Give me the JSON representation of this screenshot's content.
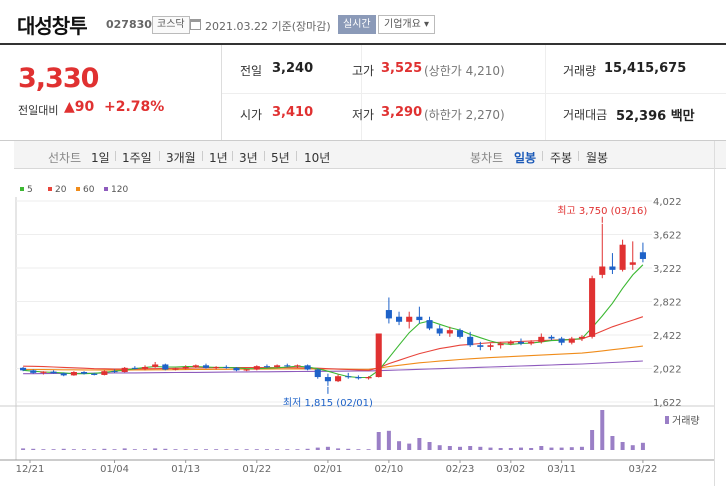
{
  "header": {
    "company_name": "대성창투",
    "code": "027830",
    "market_badge": "코스닥",
    "date_text": "2021.03.22  기준(장마감)",
    "realtime_button": "실시간",
    "company_overview_button": "기업개요 ▾"
  },
  "price": {
    "current": "3,330",
    "change_label": "전일대비",
    "change_value": "▲90",
    "change_pct": "+2.78%"
  },
  "stats": {
    "prev_close_label": "전일",
    "prev_close": "3,240",
    "high_label": "고가",
    "high": "3,525",
    "upper_limit": "(상한가 4,210)",
    "volume_label": "거래량",
    "volume": "15,415,675",
    "open_label": "시가",
    "open": "3,410",
    "low_label": "저가",
    "low": "3,290",
    "lower_limit": "(하한가 2,270)",
    "amount_label": "거래대금",
    "amount": "52,396 백만"
  },
  "toolbar": {
    "line_chart_label": "선차트",
    "periods": [
      "1일",
      "1주일",
      "3개월",
      "1년",
      "3년",
      "5년",
      "10년"
    ],
    "candle_chart_label": "봉차트",
    "candle_periods": [
      "일봉",
      "주봉",
      "월봉"
    ],
    "active_candle": "일봉"
  },
  "colors": {
    "up": "#e03131",
    "down": "#1e62c8",
    "accent": "#8b9ab8"
  },
  "chart_data": {
    "type": "candlestick",
    "legend": [
      {
        "name": "5",
        "color": "#3cb832"
      },
      {
        "name": "20",
        "color": "#e8453c"
      },
      {
        "name": "60",
        "color": "#f08c1a"
      },
      {
        "name": "120",
        "color": "#8e5bbd"
      }
    ],
    "y_ticks": [
      "4,022",
      "3,622",
      "3,222",
      "2,822",
      "2,422",
      "2,022",
      "1,622"
    ],
    "ylim": [
      1622,
      4022
    ],
    "x_ticks": [
      "12/21",
      "01/04",
      "01/13",
      "01/22",
      "02/01",
      "02/10",
      "02/23",
      "03/02",
      "03/11",
      "03/22"
    ],
    "high_annotation": "최고 3,750 (03/16)",
    "low_annotation": "최저 1,815 (02/01)",
    "volume_label": "거래량",
    "candles": [
      [
        2030,
        2040,
        1990,
        2000
      ],
      [
        2000,
        2010,
        1960,
        1970
      ],
      [
        1970,
        1990,
        1950,
        1985
      ],
      [
        1985,
        2000,
        1960,
        1965
      ],
      [
        1965,
        1975,
        1930,
        1940
      ],
      [
        1940,
        1990,
        1935,
        1980
      ],
      [
        1980,
        1990,
        1950,
        1960
      ],
      [
        1960,
        1970,
        1940,
        1945
      ],
      [
        1945,
        2000,
        1940,
        1990
      ],
      [
        1990,
        2010,
        1970,
        1980
      ],
      [
        1980,
        2040,
        1975,
        2030
      ],
      [
        2030,
        2050,
        2010,
        2020
      ],
      [
        2020,
        2060,
        2000,
        2040
      ],
      [
        2040,
        2100,
        2030,
        2070
      ],
      [
        2070,
        2080,
        2000,
        2010
      ],
      [
        2010,
        2030,
        2000,
        2020
      ],
      [
        2020,
        2060,
        2010,
        2040
      ],
      [
        2040,
        2070,
        2030,
        2060
      ],
      [
        2060,
        2080,
        2020,
        2030
      ],
      [
        2030,
        2050,
        2010,
        2040
      ],
      [
        2040,
        2060,
        2020,
        2030
      ],
      [
        2030,
        2040,
        1990,
        2000
      ],
      [
        2000,
        2020,
        1990,
        2010
      ],
      [
        2010,
        2060,
        2000,
        2050
      ],
      [
        2050,
        2070,
        2030,
        2040
      ],
      [
        2040,
        2070,
        2030,
        2060
      ],
      [
        2060,
        2080,
        2040,
        2050
      ],
      [
        2050,
        2070,
        2030,
        2060
      ],
      [
        2060,
        2070,
        2000,
        2010
      ],
      [
        2010,
        2020,
        1900,
        1920
      ],
      [
        1920,
        1960,
        1815,
        1870
      ],
      [
        1870,
        1950,
        1860,
        1930
      ],
      [
        1930,
        1970,
        1900,
        1920
      ],
      [
        1920,
        1940,
        1890,
        1905
      ],
      [
        1905,
        1930,
        1890,
        1920
      ],
      [
        1920,
        2440,
        1915,
        2440
      ],
      [
        2720,
        2870,
        2560,
        2620
      ],
      [
        2640,
        2700,
        2540,
        2580
      ],
      [
        2580,
        2700,
        2500,
        2640
      ],
      [
        2640,
        2760,
        2560,
        2600
      ],
      [
        2600,
        2640,
        2480,
        2500
      ],
      [
        2500,
        2540,
        2410,
        2440
      ],
      [
        2440,
        2520,
        2400,
        2480
      ],
      [
        2480,
        2500,
        2380,
        2400
      ],
      [
        2400,
        2460,
        2280,
        2300
      ],
      [
        2300,
        2340,
        2240,
        2280
      ],
      [
        2280,
        2320,
        2240,
        2300
      ],
      [
        2300,
        2340,
        2260,
        2320
      ],
      [
        2320,
        2360,
        2300,
        2340
      ],
      [
        2340,
        2380,
        2300,
        2320
      ],
      [
        2320,
        2360,
        2300,
        2340
      ],
      [
        2340,
        2440,
        2320,
        2400
      ],
      [
        2400,
        2420,
        2360,
        2380
      ],
      [
        2380,
        2400,
        2300,
        2330
      ],
      [
        2330,
        2400,
        2310,
        2380
      ],
      [
        2380,
        2420,
        2350,
        2400
      ],
      [
        2400,
        3130,
        2380,
        3100
      ],
      [
        3140,
        3750,
        3100,
        3240
      ],
      [
        3240,
        3400,
        3150,
        3200
      ],
      [
        3200,
        3560,
        3180,
        3500
      ],
      [
        3260,
        3540,
        3200,
        3290
      ],
      [
        3410,
        3525,
        3290,
        3330
      ]
    ],
    "ma5": [
      2000,
      1990,
      1980,
      1975,
      1970,
      1960,
      1960,
      1965,
      1975,
      1990,
      2000,
      2020,
      2035,
      2045,
      2040,
      2040,
      2045,
      2045,
      2040,
      2035,
      2035,
      2030,
      2020,
      2020,
      2025,
      2030,
      2040,
      2050,
      2040,
      2020,
      1990,
      1955,
      1925,
      1915,
      1915,
      2000,
      2150,
      2300,
      2450,
      2560,
      2590,
      2550,
      2510,
      2480,
      2430,
      2390,
      2350,
      2320,
      2310,
      2320,
      2325,
      2340,
      2355,
      2360,
      2370,
      2380,
      2510,
      2650,
      2800,
      2980,
      3140,
      3260
    ],
    "ma20": [
      2050,
      2048,
      2045,
      2040,
      2035,
      2030,
      2025,
      2020,
      2018,
      2015,
      2015,
      2016,
      2018,
      2020,
      2022,
      2024,
      2026,
      2028,
      2030,
      2032,
      2033,
      2034,
      2034,
      2034,
      2033,
      2032,
      2031,
      2030,
      2028,
      2025,
      2020,
      2015,
      2010,
      2005,
      2000,
      2030,
      2080,
      2120,
      2160,
      2200,
      2230,
      2260,
      2280,
      2300,
      2310,
      2320,
      2330,
      2335,
      2340,
      2345,
      2350,
      2355,
      2360,
      2365,
      2370,
      2375,
      2420,
      2470,
      2520,
      2560,
      2600,
      2640
    ],
    "ma60": [
      2010,
      2010,
      2009,
      2008,
      2007,
      2006,
      2005,
      2004,
      2003,
      2003,
      2003,
      2004,
      2005,
      2006,
      2007,
      2008,
      2009,
      2010,
      2011,
      2012,
      2013,
      2014,
      2015,
      2015,
      2015,
      2016,
      2016,
      2017,
      2017,
      2017,
      2016,
      2015,
      2014,
      2013,
      2012,
      2025,
      2045,
      2060,
      2075,
      2090,
      2100,
      2110,
      2120,
      2130,
      2138,
      2145,
      2152,
      2158,
      2164,
      2170,
      2176,
      2182,
      2188,
      2194,
      2200,
      2206,
      2218,
      2232,
      2246,
      2260,
      2275,
      2290
    ],
    "ma120": [
      1960,
      1960,
      1961,
      1962,
      1963,
      1964,
      1965,
      1966,
      1967,
      1968,
      1969,
      1970,
      1971,
      1972,
      1973,
      1974,
      1975,
      1976,
      1977,
      1978,
      1979,
      1980,
      1981,
      1982,
      1983,
      1984,
      1985,
      1986,
      1987,
      1988,
      1989,
      1990,
      1991,
      1992,
      1993,
      1996,
      2000,
      2004,
      2008,
      2012,
      2016,
      2020,
      2024,
      2028,
      2032,
      2036,
      2040,
      2044,
      2048,
      2052,
      2056,
      2060,
      2064,
      2068,
      2072,
      2076,
      2082,
      2088,
      2094,
      2100,
      2106,
      2112
    ],
    "volume": [
      0.04,
      0.03,
      0.02,
      0.02,
      0.03,
      0.02,
      0.02,
      0.02,
      0.03,
      0.02,
      0.04,
      0.02,
      0.02,
      0.04,
      0.03,
      0.02,
      0.02,
      0.02,
      0.02,
      0.02,
      0.02,
      0.02,
      0.02,
      0.02,
      0.02,
      0.02,
      0.02,
      0.02,
      0.03,
      0.06,
      0.08,
      0.04,
      0.03,
      0.02,
      0.02,
      0.45,
      0.48,
      0.22,
      0.16,
      0.3,
      0.2,
      0.12,
      0.1,
      0.08,
      0.1,
      0.08,
      0.06,
      0.05,
      0.05,
      0.06,
      0.05,
      0.1,
      0.06,
      0.06,
      0.07,
      0.08,
      0.5,
      1.0,
      0.35,
      0.2,
      0.12,
      0.18
    ]
  }
}
